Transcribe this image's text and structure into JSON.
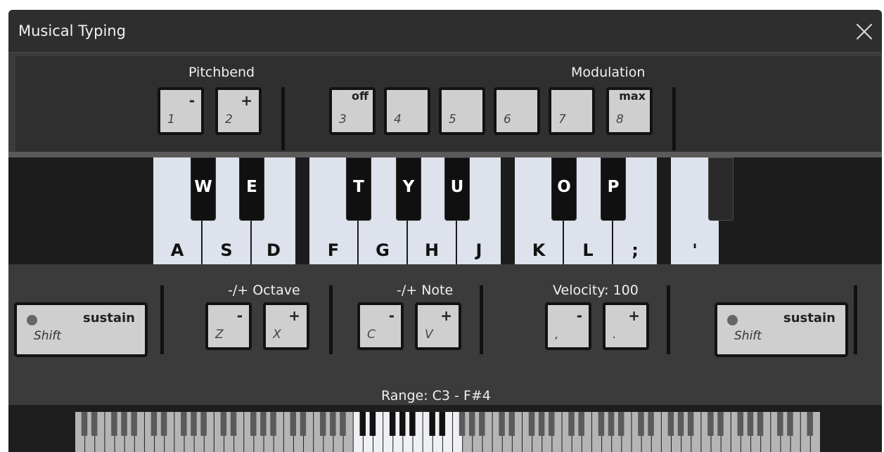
{
  "window": {
    "title": "Musical Typing"
  },
  "pitchbend": {
    "label": "Pitchbend",
    "keys": [
      {
        "key": "1",
        "mark": "-"
      },
      {
        "key": "2",
        "mark": "+"
      }
    ]
  },
  "modulation": {
    "label": "Modulation",
    "keys": [
      {
        "key": "3",
        "mark": "off"
      },
      {
        "key": "4",
        "mark": ""
      },
      {
        "key": "5",
        "mark": ""
      },
      {
        "key": "6",
        "mark": ""
      },
      {
        "key": "7",
        "mark": ""
      },
      {
        "key": "8",
        "mark": "max"
      }
    ]
  },
  "piano": {
    "white_keys": [
      "A",
      "S",
      "D",
      "F",
      "G",
      "H",
      "J",
      "K",
      "L",
      ";",
      "'"
    ],
    "black_keys": [
      "W",
      "E",
      "T",
      "Y",
      "U",
      "O",
      "P",
      ""
    ]
  },
  "sustain_left": {
    "label": "sustain",
    "key": "Shift"
  },
  "sustain_right": {
    "label": "sustain",
    "key": "Shift"
  },
  "octave": {
    "label": "-/+ Octave",
    "keys": [
      {
        "key": "Z",
        "mark": "-"
      },
      {
        "key": "X",
        "mark": "+"
      }
    ]
  },
  "note": {
    "label": "-/+ Note",
    "keys": [
      {
        "key": "C",
        "mark": "-"
      },
      {
        "key": "V",
        "mark": "+"
      }
    ]
  },
  "velocity": {
    "label": "Velocity: 100",
    "keys": [
      {
        "key": ",",
        "mark": "-"
      },
      {
        "key": ".",
        "mark": "+"
      }
    ]
  },
  "range": {
    "label": "Range: C3 - F#4"
  },
  "colors": {
    "panel": "#3b3b3b",
    "key_face": "#cfcfcf",
    "white_key": "#dde2ec",
    "black_key": "#101010"
  }
}
